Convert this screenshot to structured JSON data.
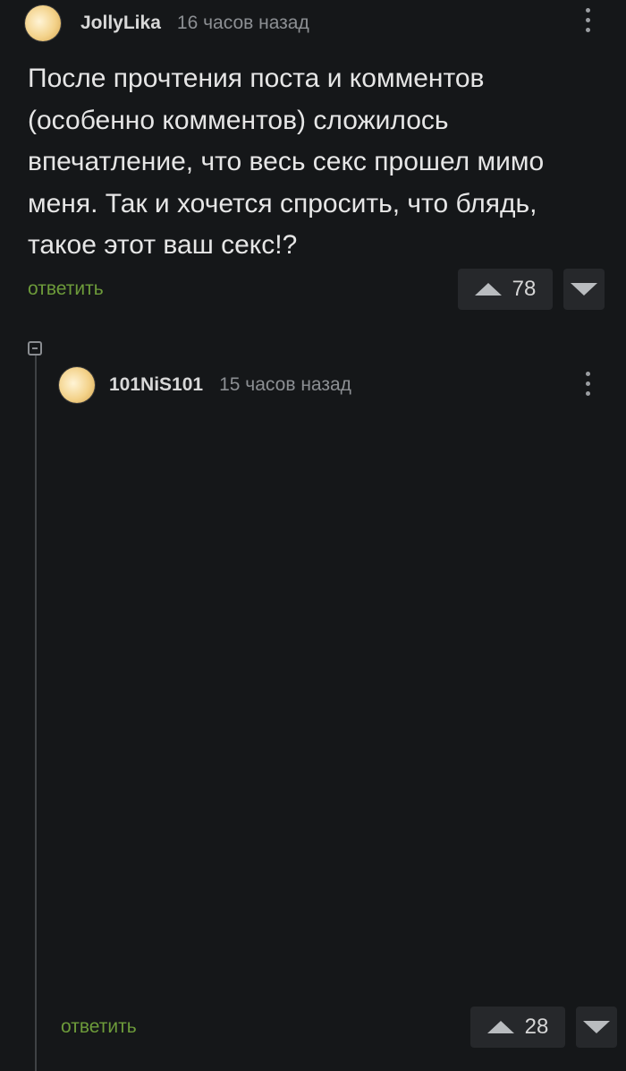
{
  "comments": [
    {
      "username": "JollyLika",
      "time": "16 часов назад",
      "text": "После прочтения поста и комментов\n(особенно комментов) сложилось\nвпечатление, что весь секс прошел мимо\nменя. Так и хочется спросить, что блядь,\nтакое этот ваш секс!?",
      "reply_label": "ответить",
      "score": "78",
      "avatar_icon": "avatar-icon"
    },
    {
      "username": "101NiS101",
      "time": "15 часов назад",
      "reply_label": "ответить",
      "score": "28",
      "avatar_icon": "avatar-icon"
    }
  ],
  "colors": {
    "background": "#151719",
    "reply": "#6d9b3a",
    "text": "#e6e6e6",
    "meta": "#8c8f93"
  }
}
